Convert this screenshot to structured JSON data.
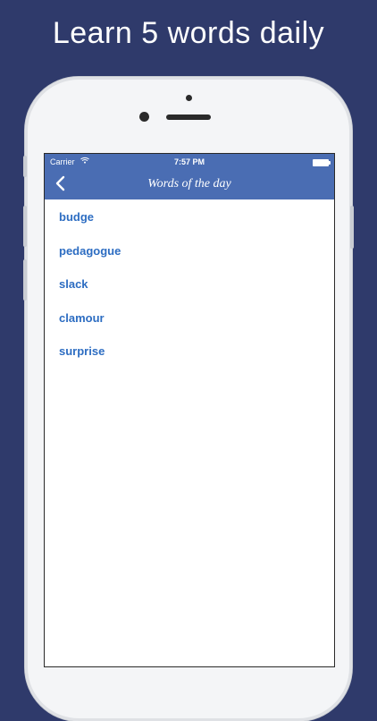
{
  "headline": "Learn 5 words daily",
  "status_bar": {
    "carrier": "Carrier",
    "time": "7:57 PM"
  },
  "nav": {
    "title": "Words of the day",
    "back_icon": "chevron-left-icon"
  },
  "words": [
    {
      "label": "budge"
    },
    {
      "label": "pedagogue"
    },
    {
      "label": "slack"
    },
    {
      "label": "clamour"
    },
    {
      "label": "surprise"
    }
  ],
  "colors": {
    "background": "#2f3a6b",
    "nav_bar": "#4a6db3",
    "word_text": "#2d6dc2",
    "phone_body": "#f4f5f7"
  }
}
